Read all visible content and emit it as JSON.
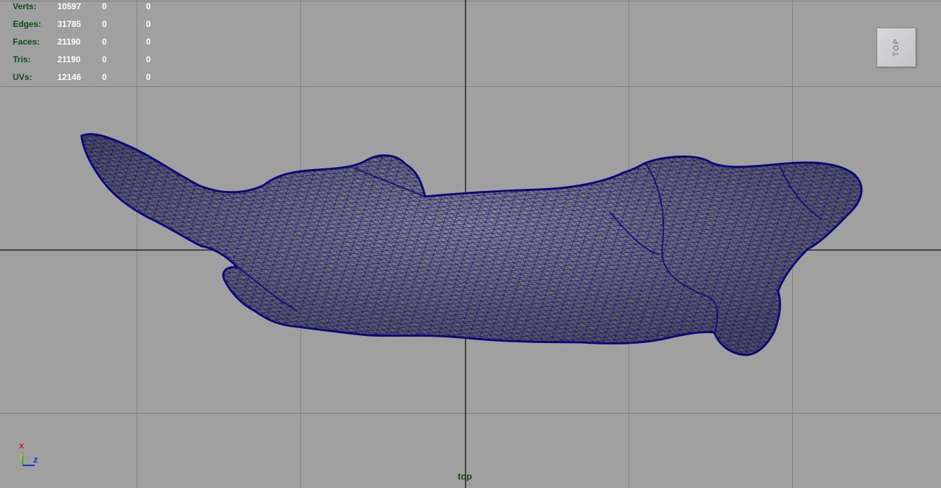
{
  "hud": {
    "rows": [
      {
        "label": "Verts:",
        "v1": "10597",
        "v2": "0",
        "v3": "0"
      },
      {
        "label": "Edges:",
        "v1": "31785",
        "v2": "0",
        "v3": "0"
      },
      {
        "label": "Faces:",
        "v1": "21190",
        "v2": "0",
        "v3": "0"
      },
      {
        "label": "Tris:",
        "v1": "21190",
        "v2": "0",
        "v3": "0"
      },
      {
        "label": "UVs:",
        "v1": "12146",
        "v2": "0",
        "v3": "0"
      }
    ]
  },
  "view_cube": {
    "label": "TOP"
  },
  "axis_gizmo": {
    "x_label": "x",
    "z_label": "z",
    "x_color": "#e01010",
    "y_color": "#20c020",
    "z_color": "#1030e0"
  },
  "view_name": "top",
  "colors": {
    "background": "#a0a0a0",
    "grid": "#7f7f7f",
    "axis_lines": "#202020",
    "wireframe": "#0a0a78",
    "mesh_shade": "#6e6e74",
    "hud_label": "#0f4d14",
    "hud_value": "#ffffff"
  }
}
